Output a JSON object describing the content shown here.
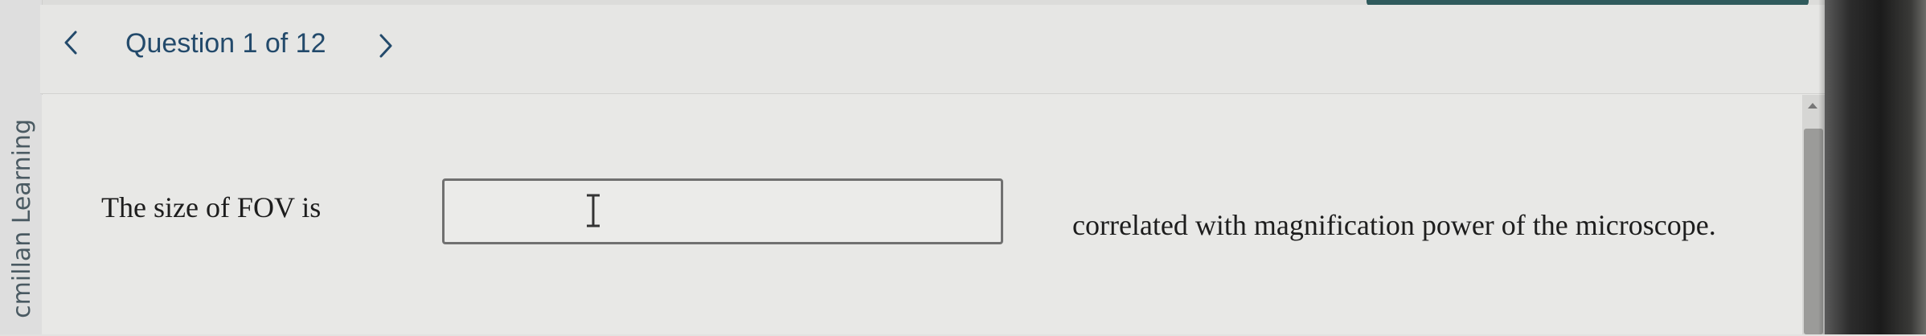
{
  "nav": {
    "title": "Question 1 of 12",
    "prev_icon": "chevron-left-icon",
    "next_icon": "chevron-right-icon"
  },
  "sidebar": {
    "brand_fragment": "cmillan Learning"
  },
  "question": {
    "text_before": "The size of FOV is",
    "answer_value": "",
    "text_after": "correlated with magnification power of the microscope.",
    "cursor_icon": "text-cursor-icon"
  },
  "colors": {
    "accent": "#2f5a5c",
    "title_text": "#234a6b",
    "body_text": "#1d1d1d",
    "input_border": "#707070"
  }
}
